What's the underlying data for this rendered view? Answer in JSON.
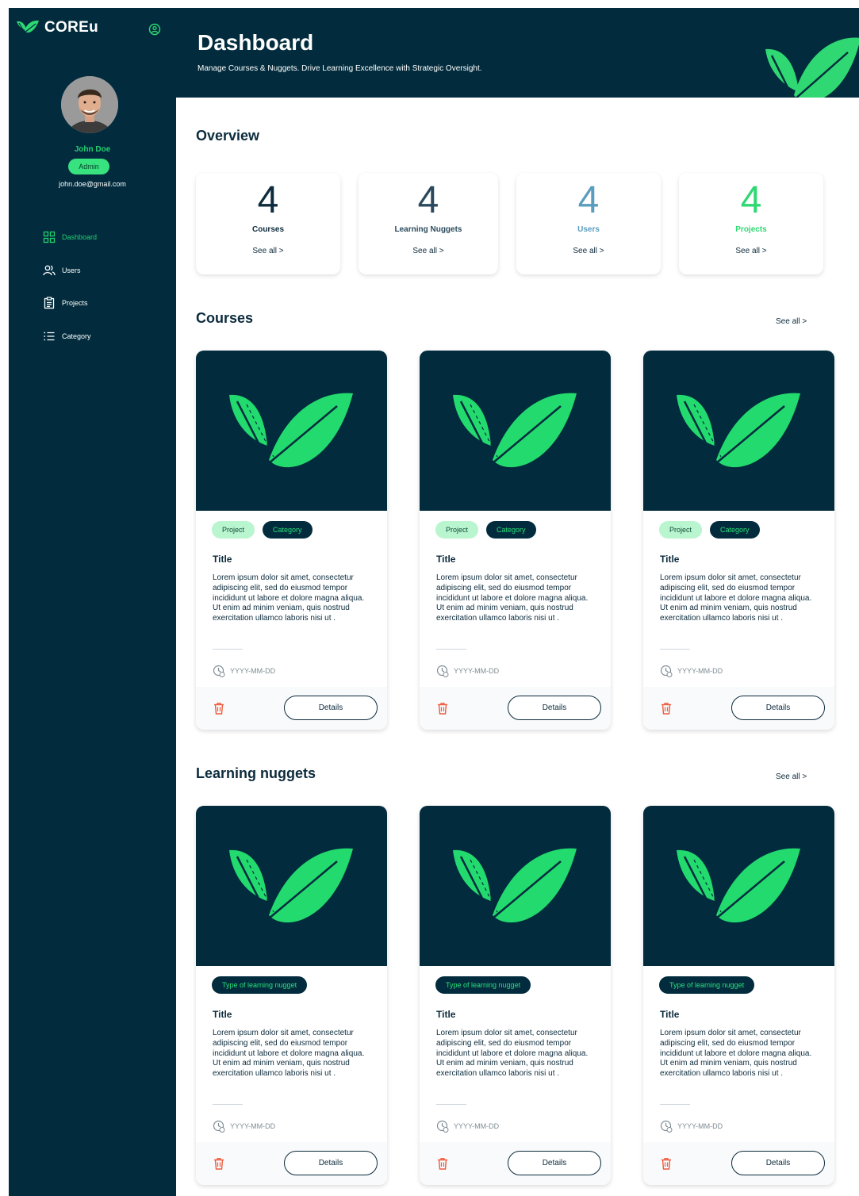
{
  "app": {
    "logo_text": "COREu"
  },
  "user": {
    "name": "John Doe",
    "role": "Admin",
    "email": "john.doe@gmail.com"
  },
  "nav": [
    {
      "label": "Dashboard",
      "icon": "dashboard-grid-icon",
      "active": true
    },
    {
      "label": "Users",
      "icon": "users-icon",
      "active": false
    },
    {
      "label": "Projects",
      "icon": "clipboard-icon",
      "active": false
    },
    {
      "label": "Category",
      "icon": "list-icon",
      "active": false
    }
  ],
  "header": {
    "title": "Dashboard",
    "subtitle": "Manage Courses & Nuggets. Drive Learning Excellence with Strategic Oversight."
  },
  "overview": {
    "title": "Overview",
    "stats": [
      {
        "value": "4",
        "label": "Courses",
        "see_all": "See all >",
        "color": "#0c2b3c"
      },
      {
        "value": "4",
        "label": "Learning Nuggets",
        "see_all": "See all >",
        "color": "#2a4a5c"
      },
      {
        "value": "4",
        "label": "Users",
        "see_all": "See all >",
        "color": "#5b9dbf"
      },
      {
        "value": "4",
        "label": "Projects",
        "see_all": "See all >",
        "color": "#2fd872"
      }
    ]
  },
  "courses": {
    "title": "Courses",
    "see_all": "See all >",
    "cards": [
      {
        "tag1": "Project",
        "tag2": "Category",
        "title": "Title",
        "desc": "Lorem ipsum dolor sit amet, consectetur adipiscing elit, sed do eiusmod tempor incididunt ut labore et dolore magna aliqua. Ut enim ad minim veniam, quis nostrud exercitation ullamco laboris nisi ut .",
        "date": "YYYY-MM-DD",
        "button": "Details"
      },
      {
        "tag1": "Project",
        "tag2": "Category",
        "title": "Title",
        "desc": "Lorem ipsum dolor sit amet, consectetur adipiscing elit, sed do eiusmod tempor incididunt ut labore et dolore magna aliqua. Ut enim ad minim veniam, quis nostrud exercitation ullamco laboris nisi ut .",
        "date": "YYYY-MM-DD",
        "button": "Details"
      },
      {
        "tag1": "Project",
        "tag2": "Category",
        "title": "Title",
        "desc": "Lorem ipsum dolor sit amet, consectetur adipiscing elit, sed do eiusmod tempor incididunt ut labore et dolore magna aliqua. Ut enim ad minim veniam, quis nostrud exercitation ullamco laboris nisi ut .",
        "date": "YYYY-MM-DD",
        "button": "Details"
      }
    ]
  },
  "nuggets": {
    "title": "Learning nuggets",
    "see_all": "See all >",
    "cards": [
      {
        "tag": "Type of learning nugget",
        "title": "Title",
        "desc": "Lorem ipsum dolor sit amet, consectetur adipiscing elit, sed do eiusmod tempor incididunt ut labore et dolore magna aliqua. Ut enim ad minim veniam, quis nostrud exercitation ullamco laboris nisi ut .",
        "date": "YYYY-MM-DD",
        "button": "Details"
      },
      {
        "tag": "Type of learning nugget",
        "title": "Title",
        "desc": "Lorem ipsum dolor sit amet, consectetur adipiscing elit, sed do eiusmod tempor incididunt ut labore et dolore magna aliqua. Ut enim ad minim veniam, quis nostrud exercitation ullamco laboris nisi ut .",
        "date": "YYYY-MM-DD",
        "button": "Details"
      },
      {
        "tag": "Type of learning nugget",
        "title": "Title",
        "desc": "Lorem ipsum dolor sit amet, consectetur adipiscing elit, sed do eiusmod tempor incididunt ut labore et dolore magna aliqua. Ut enim ad minim veniam, quis nostrud exercitation ullamco laboris nisi ut .",
        "date": "YYYY-MM-DD",
        "button": "Details"
      }
    ]
  },
  "colors": {
    "navy": "#022c3d",
    "green": "#22d06f",
    "danger": "#ef5a3c"
  }
}
